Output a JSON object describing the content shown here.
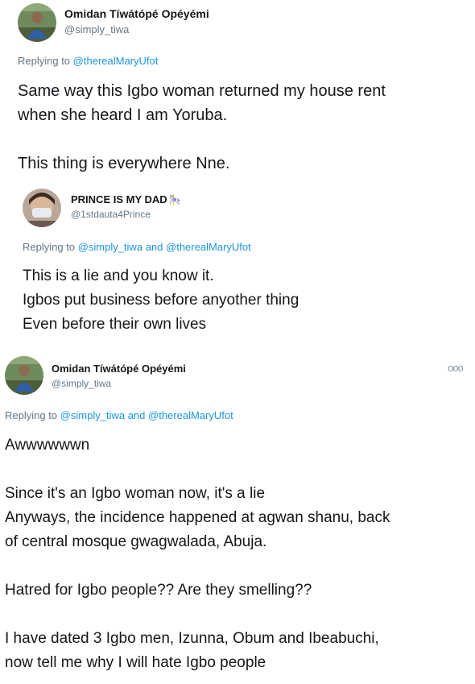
{
  "tweet1": {
    "display_name": "Omidan Tíwátópé Opéyémi",
    "handle": "@simply_tiwa",
    "replying_prefix": "Replying to",
    "replying_to": [
      "@therealMaryUfot"
    ],
    "text": "Same way this Igbo woman returned my house rent\nwhen she heard I am Yoruba.\n\nThis thing is everywhere Nne."
  },
  "quoted": {
    "display_name": "PRINCE IS MY DAD",
    "name_emoji": "🎠",
    "handle": "@1stdauta4Prince",
    "replying_prefix": "Replying to",
    "replying_to": [
      "@simply_tiwa",
      "@therealMaryUfot"
    ],
    "joiner": "and",
    "text": "This is a lie and you know it.\nIgbos put business before anyother thing\nEven before their own lives"
  },
  "tweet2": {
    "display_name": "Omidan Tíwátópé Opéyémi",
    "handle": "@simply_tiwa",
    "more_glyph": "ooo",
    "replying_prefix": "Replying to",
    "replying_to": [
      "@simply_tiwa",
      "@therealMaryUfot"
    ],
    "joiner": "and",
    "text": "Awwwwwwn\n\nSince it's an Igbo woman now, it's a lie\nAnyways, the incidence happened at agwan shanu, back\nof central mosque gwagwalada, Abuja.\n\nHatred for Igbo people?? Are they smelling??\n\nI have dated 3 Igbo men, Izunna, Obum and Ibeabuchi,\nnow tell me why I will hate Igbo people"
  },
  "colors": {
    "link": "#1b95e0",
    "secondary": "#657786",
    "text": "#14171a"
  }
}
